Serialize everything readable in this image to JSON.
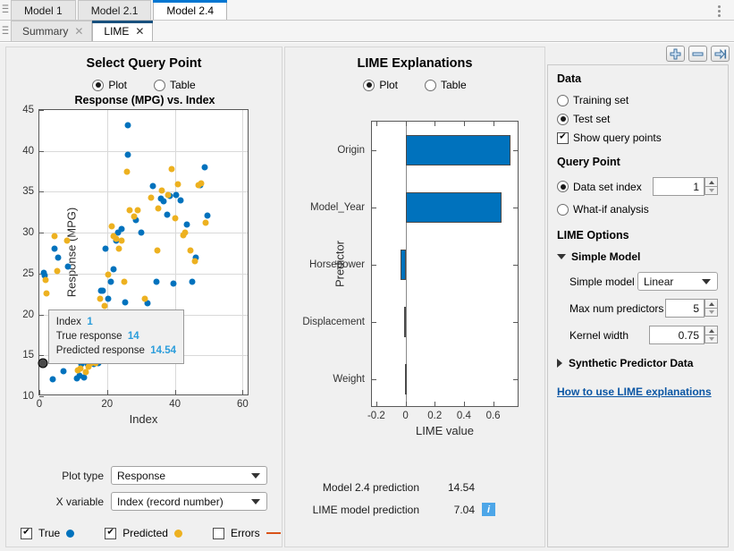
{
  "window": {
    "model_tabs": [
      {
        "label": "Model 1",
        "active": false
      },
      {
        "label": "Model 2.1",
        "active": false
      },
      {
        "label": "Model 2.4",
        "active": true
      }
    ],
    "overflow_menu": "kebab-menu",
    "doc_tabs": [
      {
        "label": "Summary",
        "active": false,
        "close": "✕"
      },
      {
        "label": "LIME",
        "active": true,
        "close": "✕"
      }
    ]
  },
  "toolbar": {
    "add_label": "+",
    "remove_label": "−",
    "collapse_label": "⇥"
  },
  "left_panel": {
    "title": "Select Query Point",
    "view_modes": [
      {
        "label": "Plot",
        "selected": true
      },
      {
        "label": "Table",
        "selected": false
      }
    ],
    "plot_type_label": "Plot type",
    "plot_type_value": "Response",
    "x_variable_label": "X variable",
    "x_variable_value": "Index (record number)",
    "legend": [
      {
        "label": "True",
        "checked": true,
        "marker": "dot",
        "color": "#0072BD"
      },
      {
        "label": "Predicted",
        "checked": true,
        "marker": "dot",
        "color": "#EDB120"
      },
      {
        "label": "Errors",
        "checked": false,
        "marker": "line",
        "color": "#D95319"
      }
    ],
    "tooltip": {
      "index_label": "Index",
      "index_value": "1",
      "true_label": "True  response",
      "true_value": "14",
      "pred_label": "Predicted  response",
      "pred_value": "14.54"
    }
  },
  "mid_panel": {
    "title": "LIME Explanations",
    "view_modes": [
      {
        "label": "Plot",
        "selected": true
      },
      {
        "label": "Table",
        "selected": false
      }
    ],
    "model_pred_label": "Model 2.4 prediction",
    "model_pred_value": "14.54",
    "lime_pred_label": "LIME model prediction",
    "lime_pred_value": "7.04",
    "info_badge": "i"
  },
  "right_panel": {
    "data_heading": "Data",
    "data_options": [
      {
        "label": "Training set",
        "selected": false
      },
      {
        "label": "Test set",
        "selected": true
      }
    ],
    "show_query_points_label": "Show query points",
    "show_query_points_checked": true,
    "query_point_heading": "Query Point",
    "query_options": [
      {
        "label": "Data set index",
        "selected": true
      },
      {
        "label": "What-if analysis",
        "selected": false
      }
    ],
    "data_set_index_value": "1",
    "lime_options_heading": "LIME Options",
    "simple_model_section": "Simple Model",
    "simple_model_label": "Simple model",
    "simple_model_value": "Linear",
    "max_num_predictors_label": "Max num predictors",
    "max_num_predictors_value": "5",
    "kernel_width_label": "Kernel width",
    "kernel_width_value": "0.75",
    "synthetic_section": "Synthetic Predictor Data",
    "help_link": "How to use LIME explanations"
  },
  "chart_data": [
    {
      "type": "scatter",
      "title": "Response (MPG) vs. Index",
      "xlabel": "Index",
      "ylabel": "Response (MPG)",
      "xlim": [
        0,
        62
      ],
      "ylim": [
        10,
        45
      ],
      "xticks": [
        0,
        20,
        40,
        60
      ],
      "yticks": [
        10,
        15,
        20,
        25,
        30,
        35,
        40,
        45
      ],
      "grid": true,
      "legend_position": "below-plot",
      "series": [
        {
          "name": "True",
          "color": "#0072BD",
          "points": [
            [
              1,
              14.0
            ],
            [
              1.2,
              25.1
            ],
            [
              1.6,
              24.8
            ],
            [
              4.0,
              12.1
            ],
            [
              4.6,
              28.0
            ],
            [
              5.6,
              26.9
            ],
            [
              7.2,
              13.1
            ],
            [
              8.4,
              25.9
            ],
            [
              11.2,
              12.2
            ],
            [
              11.8,
              12.5
            ],
            [
              12.4,
              13.9
            ],
            [
              13.2,
              12.3
            ],
            [
              14.2,
              13.9
            ],
            [
              15.4,
              14.0
            ],
            [
              16.2,
              13.9
            ],
            [
              17.4,
              14.0
            ],
            [
              18.2,
              22.9
            ],
            [
              18.6,
              22.9
            ],
            [
              19.4,
              28.0
            ],
            [
              20.4,
              21.9
            ],
            [
              21.0,
              24.0
            ],
            [
              21.8,
              25.5
            ],
            [
              22.6,
              29.0
            ],
            [
              23.2,
              30.0
            ],
            [
              24.2,
              30.5
            ],
            [
              25.4,
              21.5
            ],
            [
              26.0,
              39.5
            ],
            [
              26.2,
              43.1
            ],
            [
              28.4,
              31.5
            ],
            [
              30.0,
              30.0
            ],
            [
              31.8,
              21.4
            ],
            [
              33.4,
              35.7
            ],
            [
              34.6,
              24.0
            ],
            [
              35.8,
              34.2
            ],
            [
              36.8,
              33.8
            ],
            [
              37.6,
              32.2
            ],
            [
              38.6,
              34.5
            ],
            [
              39.6,
              23.8
            ],
            [
              40.4,
              34.6
            ],
            [
              41.6,
              34.0
            ],
            [
              43.4,
              31.0
            ],
            [
              45.0,
              24.0
            ],
            [
              46.2,
              27.0
            ],
            [
              47.6,
              35.8
            ],
            [
              48.8,
              38.0
            ],
            [
              49.6,
              32.1
            ]
          ]
        },
        {
          "name": "Predicted",
          "color": "#EDB120",
          "points": [
            [
              1.0,
              14.1
            ],
            [
              1.8,
              24.2
            ],
            [
              2.2,
              22.6
            ],
            [
              4.4,
              29.6
            ],
            [
              5.4,
              25.3
            ],
            [
              8.2,
              29.0
            ],
            [
              11.4,
              13.2
            ],
            [
              12.2,
              13.4
            ],
            [
              13.0,
              14.6
            ],
            [
              13.8,
              12.9
            ],
            [
              14.6,
              13.6
            ],
            [
              15.2,
              14.0
            ],
            [
              16.6,
              14.0
            ],
            [
              18.0,
              21.9
            ],
            [
              19.2,
              21.1
            ],
            [
              20.2,
              24.9
            ],
            [
              21.4,
              30.8
            ],
            [
              22.0,
              29.6
            ],
            [
              22.8,
              29.2
            ],
            [
              23.6,
              28.0
            ],
            [
              24.4,
              29.0
            ],
            [
              25.0,
              24.0
            ],
            [
              25.8,
              37.5
            ],
            [
              26.6,
              32.8
            ],
            [
              28.0,
              32.0
            ],
            [
              29.0,
              32.8
            ],
            [
              31.2,
              21.9
            ],
            [
              33.0,
              34.3
            ],
            [
              34.8,
              27.8
            ],
            [
              35.2,
              33.0
            ],
            [
              36.2,
              35.2
            ],
            [
              38.0,
              34.6
            ],
            [
              39.0,
              37.8
            ],
            [
              40.2,
              31.8
            ],
            [
              41.0,
              35.9
            ],
            [
              42.4,
              29.7
            ],
            [
              43.0,
              30.0
            ],
            [
              44.6,
              27.8
            ],
            [
              46.0,
              26.5
            ],
            [
              47.0,
              35.8
            ],
            [
              47.8,
              36.0
            ],
            [
              49.0,
              31.2
            ]
          ]
        }
      ],
      "query_point": {
        "x": 1,
        "y": 14
      }
    },
    {
      "type": "bar",
      "orientation": "horizontal",
      "title": "",
      "xlabel": "LIME value",
      "ylabel": "Predictor",
      "categories": [
        "Origin",
        "Model_Year",
        "Horsepower",
        "Displacement",
        "Weight"
      ],
      "values": [
        0.72,
        0.655,
        -0.035,
        -0.01,
        -0.002
      ],
      "xlim": [
        -0.23,
        0.78
      ],
      "xticks": [
        -0.2,
        0,
        0.2,
        0.4,
        0.6
      ],
      "bar_color": "#0072BD"
    }
  ]
}
